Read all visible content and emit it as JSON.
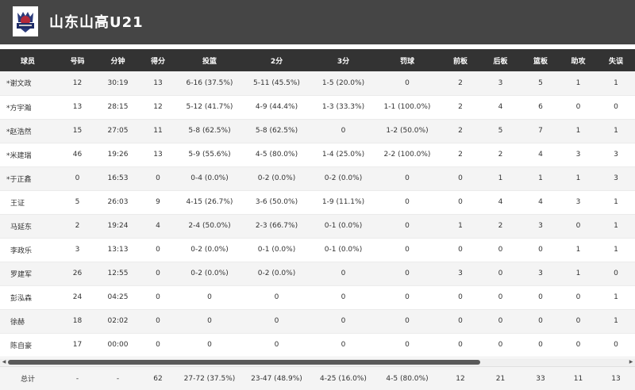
{
  "team": {
    "name": "山东山高U21",
    "logo_icon": "team-logo-icon"
  },
  "columns": [
    "球员",
    "号码",
    "分钟",
    "得分",
    "投篮",
    "2分",
    "3分",
    "罚球",
    "前板",
    "后板",
    "篮板",
    "助攻",
    "失误"
  ],
  "players": [
    [
      "*谢文政",
      "12",
      "30:19",
      "13",
      "6-16 (37.5%)",
      "5-11 (45.5%)",
      "1-5 (20.0%)",
      "0",
      "2",
      "3",
      "5",
      "1",
      "1"
    ],
    [
      "*方宇瀚",
      "13",
      "28:15",
      "12",
      "5-12 (41.7%)",
      "4-9 (44.4%)",
      "1-3 (33.3%)",
      "1-1 (100.0%)",
      "2",
      "4",
      "6",
      "0",
      "0"
    ],
    [
      "*赵浩然",
      "15",
      "27:05",
      "11",
      "5-8 (62.5%)",
      "5-8 (62.5%)",
      "0",
      "1-2 (50.0%)",
      "2",
      "5",
      "7",
      "1",
      "1"
    ],
    [
      "*米建瑞",
      "46",
      "19:26",
      "13",
      "5-9 (55.6%)",
      "4-5 (80.0%)",
      "1-4 (25.0%)",
      "2-2 (100.0%)",
      "2",
      "2",
      "4",
      "3",
      "3"
    ],
    [
      "*于正鑫",
      "0",
      "16:53",
      "0",
      "0-4 (0.0%)",
      "0-2 (0.0%)",
      "0-2 (0.0%)",
      "0",
      "0",
      "1",
      "1",
      "1",
      "3"
    ],
    [
      "王证",
      "5",
      "26:03",
      "9",
      "4-15 (26.7%)",
      "3-6 (50.0%)",
      "1-9 (11.1%)",
      "0",
      "0",
      "4",
      "4",
      "3",
      "1"
    ],
    [
      "马延东",
      "2",
      "19:24",
      "4",
      "2-4 (50.0%)",
      "2-3 (66.7%)",
      "0-1 (0.0%)",
      "0",
      "1",
      "2",
      "3",
      "0",
      "1"
    ],
    [
      "李政乐",
      "3",
      "13:13",
      "0",
      "0-2 (0.0%)",
      "0-1 (0.0%)",
      "0-1 (0.0%)",
      "0",
      "0",
      "0",
      "0",
      "1",
      "1"
    ],
    [
      "罗建军",
      "26",
      "12:55",
      "0",
      "0-2 (0.0%)",
      "0-2 (0.0%)",
      "0",
      "0",
      "3",
      "0",
      "3",
      "1",
      "0"
    ],
    [
      "彭泓森",
      "24",
      "04:25",
      "0",
      "0",
      "0",
      "0",
      "0",
      "0",
      "0",
      "0",
      "0",
      "1"
    ],
    [
      "徐赫",
      "18",
      "02:02",
      "0",
      "0",
      "0",
      "0",
      "0",
      "0",
      "0",
      "0",
      "0",
      "1"
    ],
    [
      "陈自豪",
      "17",
      "00:00",
      "0",
      "0",
      "0",
      "0",
      "0",
      "0",
      "0",
      "0",
      "0",
      "0"
    ]
  ],
  "totals": [
    "总计",
    "-",
    "-",
    "62",
    "27-72 (37.5%)",
    "23-47 (48.9%)",
    "4-25 (16.0%)",
    "4-5 (80.0%)",
    "12",
    "21",
    "33",
    "11",
    "13"
  ],
  "colors": {
    "header_bg": "#454545",
    "table_header_bg": "#333333",
    "row_alt": "#f4f4f4"
  }
}
